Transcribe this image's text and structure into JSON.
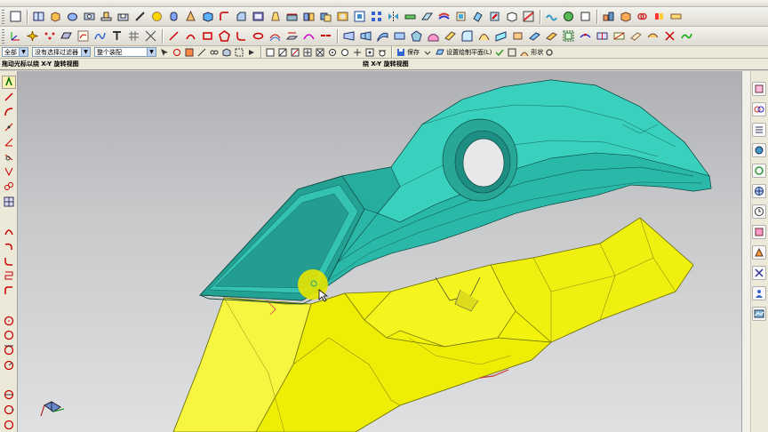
{
  "toolbar": {
    "filter_combo": "全部",
    "select_filter_combo": "没有选择过滤器",
    "assembly_combo": "整个装配",
    "save_label": "保存",
    "set_work_plane_label": "设置绘制平面(L)",
    "shape_label": "形状"
  },
  "cue_line": {
    "left": "拖动光标以绕 X-Y 旋转视图",
    "right": "绕 X-Y 旋转视图"
  },
  "colors": {
    "part_teal": "#2bb5a6",
    "part_yellow": "#f2f20c",
    "background_top": "#aeb0b3",
    "background_bottom": "#dfe0e1"
  }
}
